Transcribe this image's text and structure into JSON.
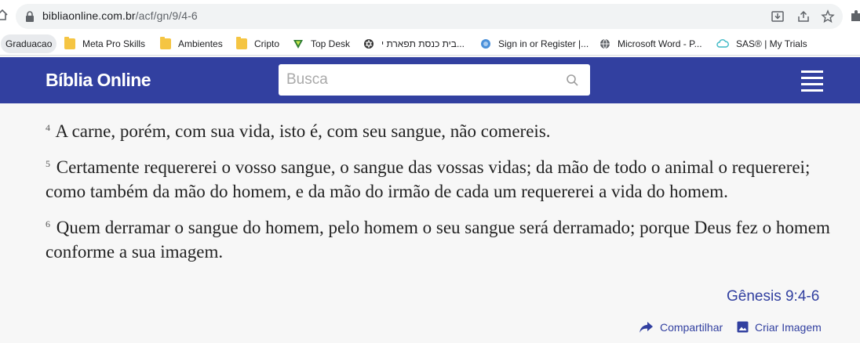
{
  "browser": {
    "url_host": "bibliaonline.com.br",
    "url_path": "/acf/gn/9/4-6"
  },
  "bookmarks": [
    {
      "label": "Graduacao",
      "icon": "none"
    },
    {
      "label": "Meta Pro Skills",
      "icon": "folder-icon"
    },
    {
      "label": "Ambientes",
      "icon": "folder-icon"
    },
    {
      "label": "Cripto",
      "icon": "folder-icon"
    },
    {
      "label": "Top Desk",
      "icon": "topdesk-icon"
    },
    {
      "label": "בית כנסת תפארת י...",
      "icon": "synagogue-icon"
    },
    {
      "label": "Sign in or Register |...",
      "icon": "globe-icon"
    },
    {
      "label": "Microsoft Word - P...",
      "icon": "world-icon"
    },
    {
      "label": "SAS® | My Trials",
      "icon": "cloud-icon"
    }
  ],
  "site": {
    "brand": "Bíblia Online",
    "search_placeholder": "Busca"
  },
  "verses": [
    {
      "num": "4",
      "text": "A carne, porém, com sua vida, isto é, com seu sangue, não comereis."
    },
    {
      "num": "5",
      "text": "Certamente requererei o vosso sangue, o sangue das vossas vidas; da mão de todo o animal o requererei; como também da mão do homem, e da mão do irmão de cada um requererei a vida do homem."
    },
    {
      "num": "6",
      "text": "Quem derramar o sangue do homem, pelo homem o seu sangue será derramado; porque Deus fez o homem conforme a sua imagem."
    }
  ],
  "reference": "Gênesis 9:4-6",
  "actions": {
    "share": "Compartilhar",
    "create_image": "Criar Imagem"
  },
  "colors": {
    "header_bg": "#3240a0",
    "accent": "#3240a0"
  }
}
